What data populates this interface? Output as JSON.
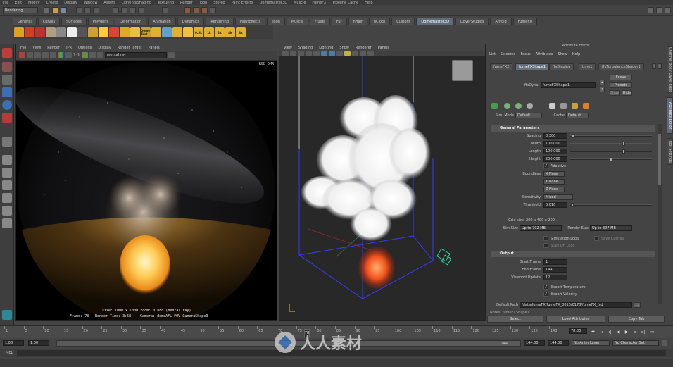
{
  "menu": [
    "File",
    "Edit",
    "Modify",
    "Create",
    "Display",
    "Window",
    "Assets",
    "Lighting/Shading",
    "Texturing",
    "Render",
    "Toon",
    "Stereo",
    "Paint Effects",
    "Domemaster3D",
    "Muscle",
    "FumeFX",
    "Pipeline Cache",
    "Help"
  ],
  "mode_select": "Rendering",
  "shelf_tabs": [
    "General",
    "Curves",
    "Surfaces",
    "Polygons",
    "Deformation",
    "Animation",
    "Dynamics",
    "Rendering",
    "PaintEffects",
    "Toon",
    "Muscle",
    "Fluids",
    "Fur",
    "nHair",
    "nCloth",
    "Custom",
    "Domemaster3D",
    "DoverStudios",
    "Arnold",
    "FumeFX"
  ],
  "shelf_tab_active": "Domemaster3D",
  "shelf_icons": [
    "",
    "",
    "",
    "",
    "",
    "",
    "",
    "",
    "",
    "",
    "",
    "",
    "Dome Text",
    "",
    "",
    "",
    "",
    "0.5k",
    "1k",
    "2k",
    "4k",
    "8k"
  ],
  "render_view": {
    "menu": [
      "File",
      "View",
      "Render",
      "IPR",
      "Options",
      "Display",
      "Render Target",
      "Panels"
    ],
    "renderer": "mental ray",
    "ratio": "1:1",
    "hud_right": "RGB  DMR",
    "hud_size": "size: 1000 x 1000  zoom: 0.888     (mental ray)",
    "hud_frame": "Frame: 78",
    "hud_time": "Render Time: 3:58",
    "hud_camera": "Camera: domeAFL_FOV_CameraShape3"
  },
  "persp_view": {
    "menu": [
      "View",
      "Shading",
      "Lighting",
      "Show",
      "Renderer",
      "Panels"
    ]
  },
  "attr_editor": {
    "title": "Attribute Editor",
    "menu": [
      "List",
      "Selected",
      "Focus",
      "Attributes",
      "Show",
      "Help"
    ],
    "tabs": [
      "fumeFX2",
      "fumeFXShape1",
      "ffxDisplay",
      "time1",
      "ffxTurbulenceShader1"
    ],
    "active_tab": "fumeFXShape1",
    "focus": "Focus",
    "presets": "Presets",
    "show": "Show",
    "hide": "Hide",
    "node_label": "ffxDyna:",
    "node_value": "fumeFXShape1",
    "sim_mode_label": "Sim. Mode",
    "sim_mode": "Default",
    "cache_label": "Cache",
    "cache": "Default",
    "general_header": "General Parameters",
    "spacing_label": "Spacing",
    "spacing": "0.300",
    "width_label": "Width",
    "width": "100.000",
    "length_label": "Length",
    "length": "100.000",
    "height_label": "Height",
    "height": "200.000",
    "adaptive": "Adaptive",
    "boundless_label": "Boundless",
    "bx": "X None",
    "by": "Y None",
    "bz": "Z None",
    "sensitivity_label": "Sensitivity",
    "sensitivity": "Mixed",
    "threshold_label": "Threshold",
    "threshold": "0.010",
    "grid_size": "Grid size: 200 x 400 x 200",
    "sim_size_label": "Sim Size",
    "sim_size": "Up to 702 MB",
    "render_size_label": "Render Size",
    "render_size": "Up to 397 MB",
    "simulation_loop": "Simulation Loop",
    "save_caches": "Save Caches",
    "start_on_load": "Start On Load",
    "output_header": "Output",
    "start_frame_label": "Start Frame",
    "start_frame": "1",
    "end_frame_label": "End Frame",
    "end_frame": "144",
    "viewport_update_label": "Viewport Update",
    "viewport_update": "12",
    "export_temperature": "Export Temperature",
    "export_velocity": "Export Velocity",
    "default_path_label": "Default Path",
    "default_path": "/data/fumeFX/fumeFX_0015/0178/fumeFX_fxd",
    "bottom_node": "Notes: fumeFXShape1",
    "select_btn": "Select",
    "load_attr_btn": "Load Attributes",
    "copy_tab_btn": "Copy Tab"
  },
  "side_tabs": [
    "Channel Box / Layer Editor",
    "Attribute Editor",
    "Tool Settings"
  ],
  "timeline": {
    "ticks": [
      "1",
      "5",
      "10",
      "15",
      "20",
      "25",
      "30",
      "35",
      "40",
      "45",
      "50",
      "55",
      "60",
      "65",
      "70",
      "75",
      "80",
      "85",
      "90",
      "95",
      "100",
      "105",
      "110",
      "115",
      "120",
      "125",
      "130",
      "135",
      "140"
    ],
    "current_frame": "78",
    "current_frame_field": "78.00",
    "current_frame_fraction": 0.535
  },
  "range": {
    "start": "1.00",
    "start2": "1.00",
    "end": "144",
    "end2": "144.00",
    "end3": "144.00",
    "anim_layer": "No Anim Layer",
    "char_set": "No Character Set"
  },
  "cmd_label": "MEL",
  "watermark": "人人素材",
  "colors": {
    "accent": "#5e6a7a",
    "bg": "#444444"
  }
}
